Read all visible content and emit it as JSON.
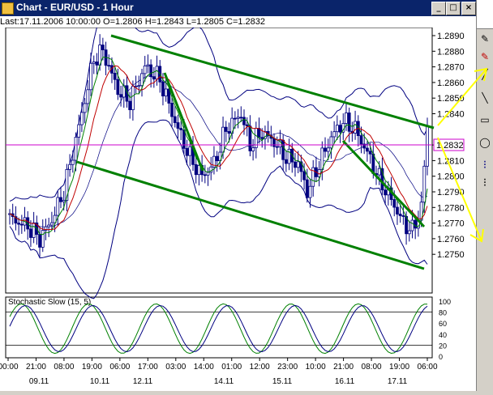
{
  "window": {
    "title": "Chart - EUR/USD - 1 Hour",
    "buttons": {
      "minimize": "_",
      "maximize": "□",
      "close": "×"
    }
  },
  "info_line": "Last:17.11.2006 10:00:00 O=1.2806 H=1.2843 L=1.2805 C=1.2832",
  "chart": {
    "price_axis": [
      "1.2890",
      "1.2880",
      "1.2870",
      "1.2860",
      "1.2850",
      "1.2840",
      "1.2832",
      "1.2820",
      "1.2810",
      "1.2800",
      "1.2790",
      "1.2780",
      "1.2770",
      "1.2760",
      "1.2750"
    ],
    "current_price": "1.2832",
    "colors": {
      "candles": "#000080",
      "bollinger": "#000080",
      "ma_fast": "#008000",
      "ma_slow": "#c00000",
      "trend": "#008000",
      "price_line": "#cc00cc",
      "arrows": "#ffff00"
    },
    "stochastic": {
      "title": "Stochastic Slow (15, 5)",
      "axis": [
        "100",
        "80",
        "60",
        "40",
        "20",
        "0"
      ]
    },
    "time_labels": [
      "00:00",
      "21:00",
      "08:00",
      "19:00",
      "06:00",
      "17:00",
      "03:00",
      "14:00",
      "01:00",
      "12:00",
      "23:00",
      "10:00",
      "21:00",
      "08:00",
      "19:00",
      "06:00"
    ],
    "date_labels": [
      "09.11",
      "10.11",
      "12.11",
      "14.11",
      "15.11",
      "16.11",
      "17.11"
    ]
  },
  "toolbar": {
    "tools": [
      "pencil-icon",
      "pencil-icon",
      "line-icon",
      "circle-icon",
      "list-icon"
    ]
  }
}
